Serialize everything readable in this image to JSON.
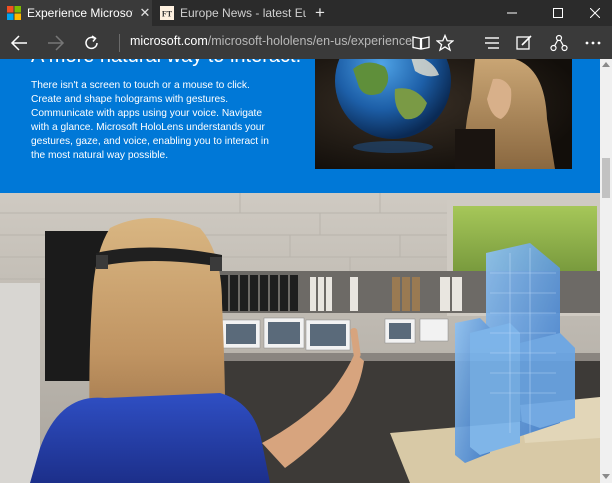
{
  "window": {
    "tabs": [
      {
        "label": "Experience Microsoft Hc",
        "active": true,
        "icon": "microsoft-logo-icon"
      },
      {
        "label": "Europe News - latest Europe",
        "active": false,
        "icon": "ft-logo-icon",
        "icon_text": "FT"
      }
    ],
    "new_tab_label": "+",
    "tab_close_glyph": "✕"
  },
  "address_bar": {
    "domain": "microsoft.com",
    "path": "/microsoft-hololens/en-us/experience"
  },
  "page": {
    "heading": "A more natural way to interact.",
    "paragraph": "There isn't a screen to touch or a mouse to click. Create and shape holograms with gestures. Communicate with apps using your voice. Navigate with a glance. Microsoft HoloLens understands your gestures, gaze, and voice, enabling you to interact in the most natural way possible."
  },
  "colors": {
    "accent_blue": "#0078d7",
    "chrome_dark": "#2b2b2b",
    "chrome_mid": "#3a3a3a"
  }
}
